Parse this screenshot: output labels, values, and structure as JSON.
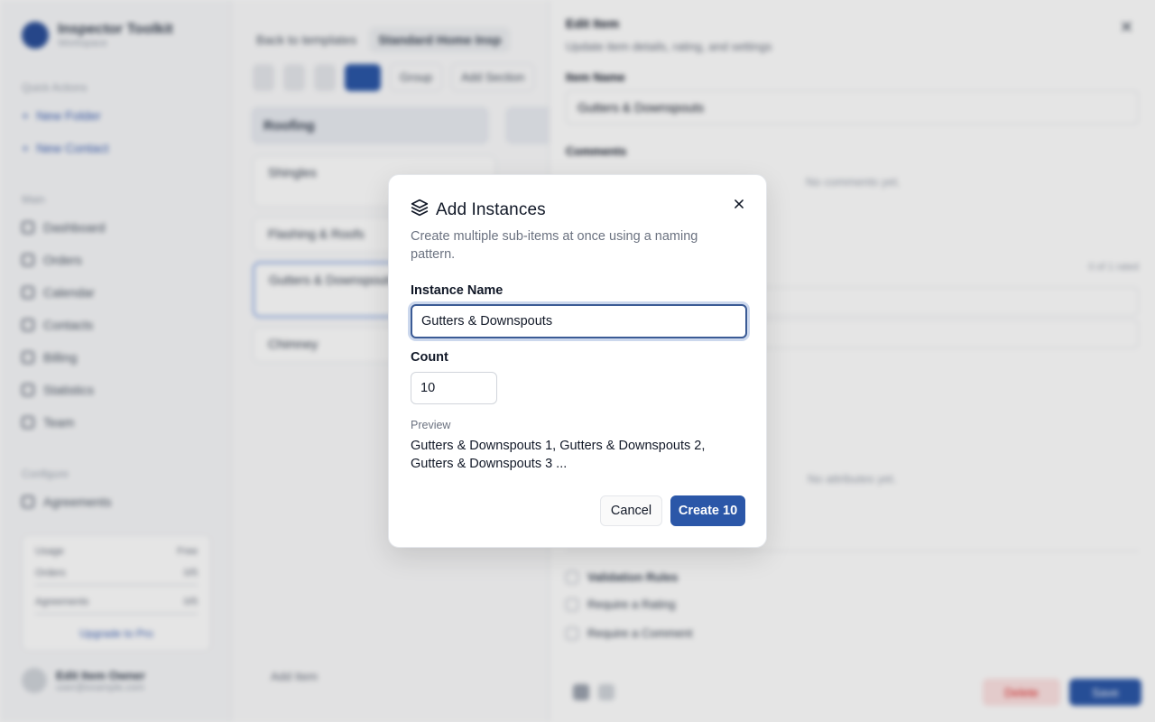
{
  "app": {
    "brand_title": "Inspector Toolkit",
    "brand_sub": "Workspace",
    "sidebar": {
      "quick_actions_label": "Quick Actions",
      "quick_actions": [
        "New Folder",
        "New Contact"
      ],
      "main_label": "Main",
      "main_items": [
        "Dashboard",
        "Orders",
        "Calendar",
        "Contacts",
        "Billing",
        "Statistics",
        "Team"
      ],
      "configure_label": "Configure",
      "configure_items": [
        "Agreements"
      ],
      "usage": {
        "header_left": "Usage",
        "header_right": "Free",
        "rows": [
          {
            "label": "Orders",
            "value": "0/5"
          },
          {
            "label": "Agreements",
            "value": "0/5"
          }
        ],
        "upgrade_link": "Upgrade to Pro"
      },
      "user": {
        "name": "Edit Item Owner",
        "email": "user@example.com"
      }
    },
    "main": {
      "back_link": "Back to templates",
      "template_chip": "Standard Home Insp",
      "toolbar_group": "Group",
      "toolbar_add": "Add Section",
      "column_title": "Roofing",
      "cards": [
        "Shingles",
        "Flashing & Roofs",
        "Gutters & Downspouts",
        "Chimney"
      ],
      "add_item": "Add Item"
    },
    "panel": {
      "title": "Edit Item",
      "subtitle": "Update item details, rating, and settings",
      "item_name_label": "Item Name",
      "item_name_value": "Gutters & Downspouts",
      "comments_label": "Comments",
      "no_comments": "No comments yet.",
      "counter": "0 of 1 rated",
      "no_attributes": "No attributes yet.",
      "validation_label": "Validation Rules",
      "rules": [
        "Require a Rating",
        "Require a Comment"
      ],
      "delete_label": "Delete",
      "save_label": "Save"
    }
  },
  "modal": {
    "title": "Add Instances",
    "title_icon": "layers-icon",
    "description": "Create multiple sub-items at once using a naming pattern.",
    "instance_name_label": "Instance Name",
    "instance_name_value": "Gutters & Downspouts",
    "count_label": "Count",
    "count_value": "10",
    "preview_label": "Preview",
    "preview_text": "Gutters & Downspouts 1, Gutters & Downspouts 2, Gutters & Downspouts 3 ...",
    "cancel_label": "Cancel",
    "create_label": "Create 10",
    "accent_color": "#2b57a8"
  }
}
